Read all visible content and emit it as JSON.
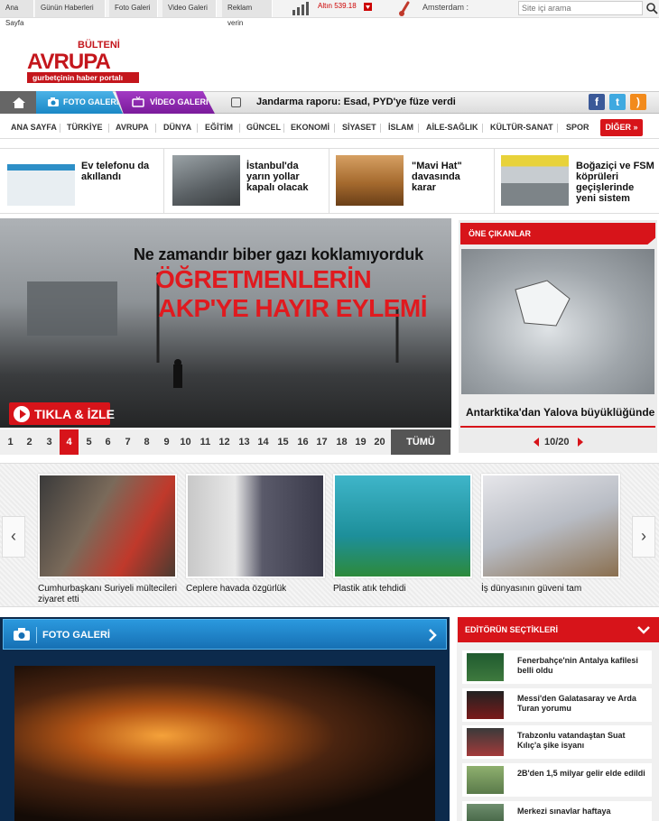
{
  "topbar": {
    "links": [
      "Ana Sayfa",
      "Günün Haberleri",
      "Foto Galeri",
      "Video Galeri",
      "Reklam verin"
    ],
    "gold": "Altın 539.18",
    "city": "Amsterdam :",
    "search_placeholder": "Site içi arama"
  },
  "logo": {
    "top": "BÜLTENİ",
    "main": "AVRUPA",
    "tagline": "gurbetçinin haber portalı"
  },
  "sectionbar": {
    "foto_tab": "FOTO GALERİ",
    "video_tab": "VİDEO GALERİ",
    "ticker": "Jandarma raporu: Esad, PYD'ye füze verdi"
  },
  "nav": {
    "items": [
      "ANA SAYFA",
      "TÜRKİYE",
      "AVRUPA",
      "DÜNYA",
      "EĞİTİM",
      "GÜNCEL",
      "EKONOMİ",
      "SİYASET",
      "İSLAM",
      "AİLE-SAĞLIK",
      "KÜLTÜR-SANAT",
      "SPOR"
    ],
    "more": "DİĞER »"
  },
  "strip": [
    "Ev telefonu da akıllandı",
    "İstanbul'da yarın yollar kapalı olacak",
    "\"Mavi Hat\" davasında karar",
    "Boğaziçi ve FSM köprüleri geçişlerinde yeni sistem"
  ],
  "hero": {
    "line1": "Ne zamandır biber gazı koklamıyorduk",
    "line2": "ÖĞRETMENLERİN",
    "line3": "AKP'YE HAYIR EYLEMİ",
    "watch": "TIKLA & İZLE",
    "pages": [
      "1",
      "2",
      "3",
      "4",
      "5",
      "6",
      "7",
      "8",
      "9",
      "10",
      "11",
      "12",
      "13",
      "14",
      "15",
      "16",
      "17",
      "18",
      "19",
      "20"
    ],
    "active_page": "4",
    "all": "TÜMÜ"
  },
  "featured": {
    "label": "ÖNE ÇIKANLAR",
    "title": "Antarktika'dan Yalova büyüklüğünde",
    "counter": "10/20"
  },
  "carousel": [
    "Cumhurbaşkanı Suriyeli mültecileri ziyaret etti",
    "Ceplere havada özgürlük",
    "Plastik atık tehdidi",
    "İş dünyasının güveni tam"
  ],
  "foto_galeri": {
    "label": "FOTO GALERİ"
  },
  "editor": {
    "label": "EDİTÖRÜN SEÇTİKLERİ",
    "items": [
      "Fenerbahçe'nin Antalya kafilesi belli oldu",
      "Messi'den Galatasaray ve Arda Turan yorumu",
      "Trabzonlu vatandaştan Suat Kılıç'a şike isyanı",
      "2B'den 1,5 milyar gelir elde edildi",
      "Merkezi sınavlar haftaya"
    ]
  }
}
